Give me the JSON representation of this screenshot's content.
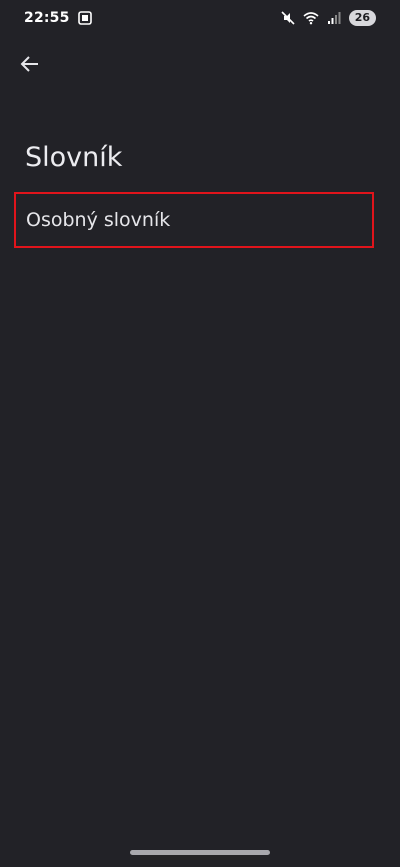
{
  "status_bar": {
    "time": "22:55",
    "battery_level": "26",
    "icons": {
      "screenshot": "screenshot-icon",
      "mute": "mute-icon",
      "wifi": "wifi-icon",
      "signal": "signal-icon"
    }
  },
  "app_bar": {
    "back_icon": "back-arrow-icon"
  },
  "page": {
    "title": "Slovník",
    "items": [
      {
        "label": "Osobný slovník"
      }
    ]
  },
  "colors": {
    "background": "#222227",
    "highlight_border": "#e0141b",
    "text": "#e6e6ea"
  }
}
